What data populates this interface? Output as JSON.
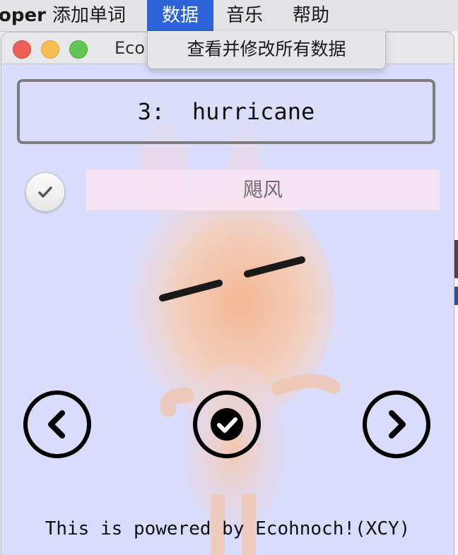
{
  "menubar": {
    "app_name": "oper",
    "items": [
      "添加单词",
      "数据",
      "音乐",
      "帮助"
    ],
    "active_index": 1
  },
  "dropdown": {
    "items": [
      "查看并修改所有数据"
    ]
  },
  "window": {
    "title": "Eco",
    "word_display": "3:  hurricane",
    "meaning": "飓风",
    "known_checked": true,
    "footer": "This is powered by Ecohnoch!(XCY)"
  },
  "icons": {
    "prev": "chevron-left-circle-icon",
    "confirm": "check-circle-icon",
    "next": "chevron-right-circle-icon",
    "toggle": "checkmark-icon"
  },
  "colors": {
    "menu_active": "#2d63d8",
    "window_bg": "#d9dcfb",
    "meaning_bg": "#fae4f2"
  }
}
